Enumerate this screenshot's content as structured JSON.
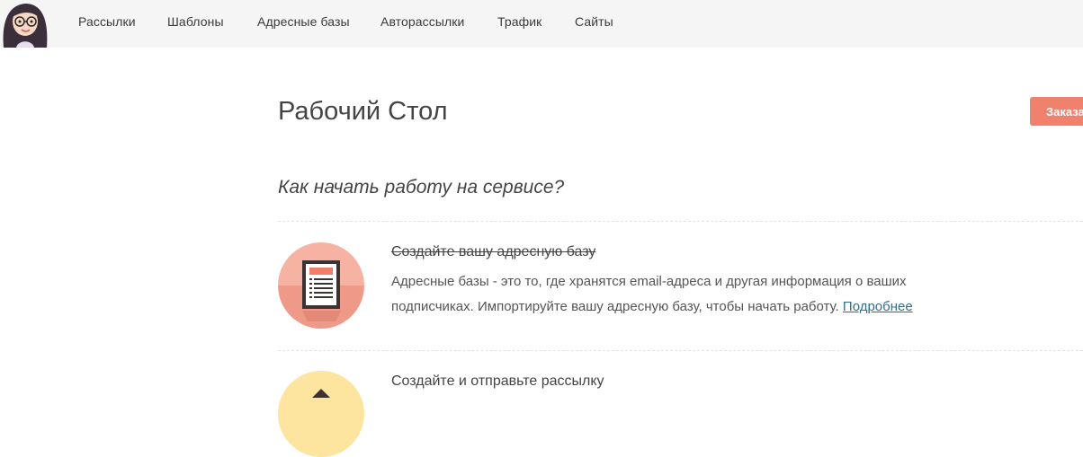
{
  "nav": {
    "items": [
      "Рассылки",
      "Шаблоны",
      "Адресные базы",
      "Авторассылки",
      "Трафик",
      "Сайты"
    ]
  },
  "page": {
    "title": "Рабочий Стол",
    "order_button": "Заказа"
  },
  "getting_started": {
    "heading": "Как начать работу на сервисе?",
    "steps": [
      {
        "title": "Создайте вашу адресную базу",
        "completed": true,
        "desc_line1": "Адресные базы - это то, где хранятся email-адреса и другая информация о ваших",
        "desc_line2": "подписчиках. Импортируйте вашу адресную базу, чтобы начать работу.",
        "more_link": "Подробнее",
        "icon": "document-list-icon"
      },
      {
        "title": "Создайте и отправьте рассылку",
        "completed": false,
        "icon": "envelope-icon"
      }
    ]
  },
  "colors": {
    "nav_bg": "#f5f5f5",
    "accent": "#f0816c",
    "step1_icon_bg": "#f0a898",
    "step2_icon_bg": "#fde5a0",
    "link": "#2f6f8f"
  }
}
